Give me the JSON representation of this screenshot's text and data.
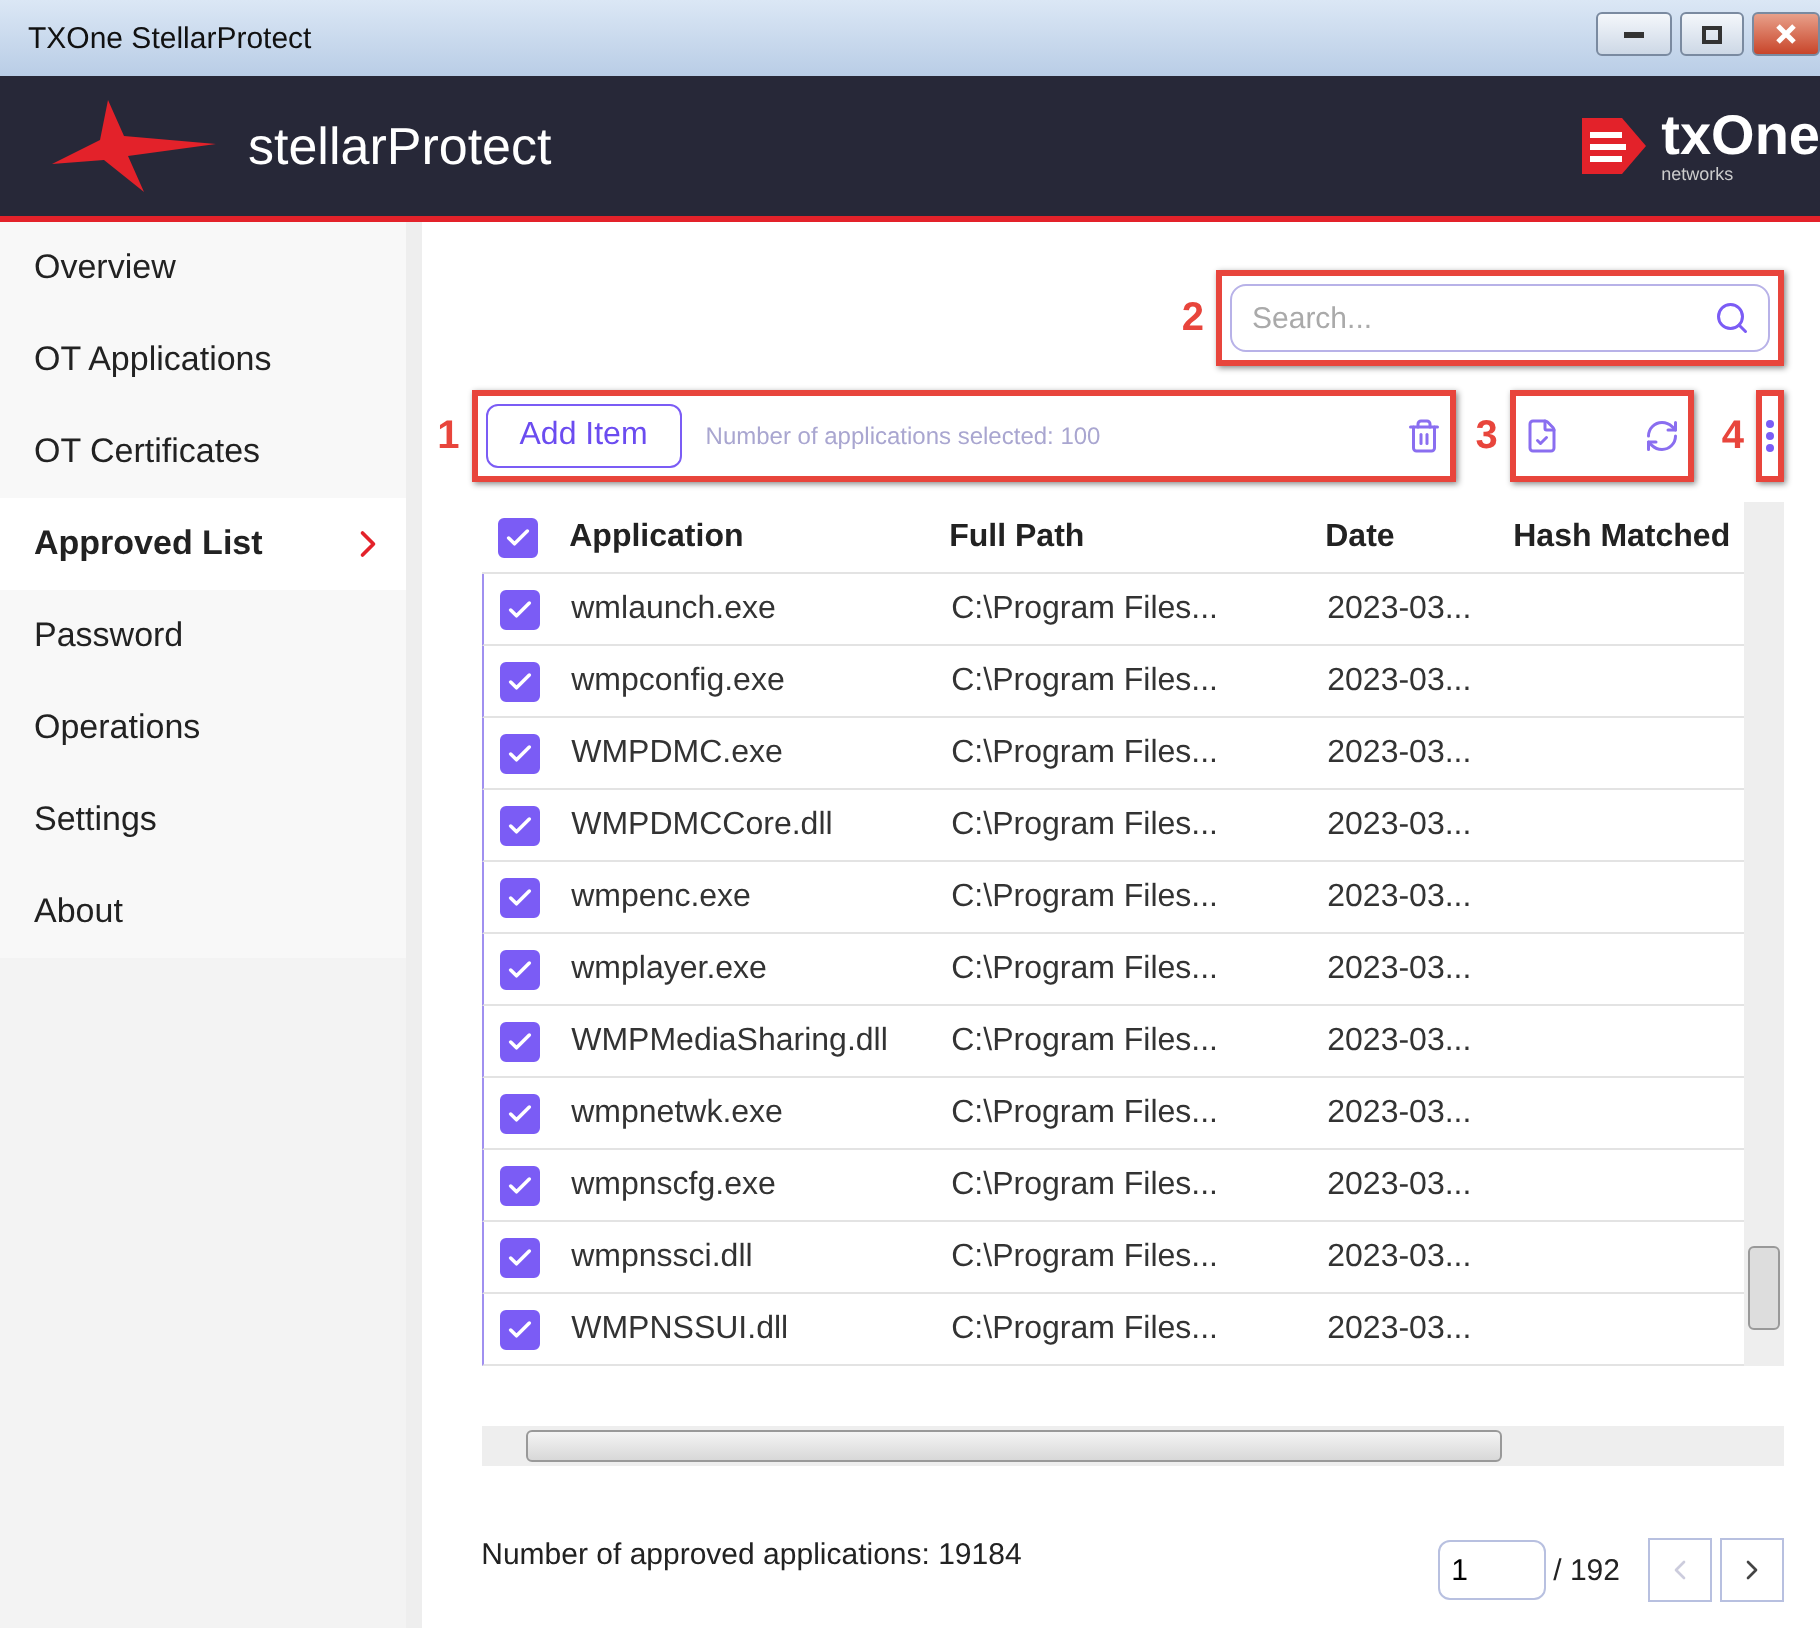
{
  "window": {
    "title": "TXOne StellarProtect"
  },
  "header": {
    "product": "stellarProtect",
    "brand": "txOne",
    "brand_sub": "networks"
  },
  "sidebar": {
    "items": [
      {
        "label": "Overview",
        "selected": false
      },
      {
        "label": "OT Applications",
        "selected": false
      },
      {
        "label": "OT Certificates",
        "selected": false
      },
      {
        "label": "Approved List",
        "selected": true
      },
      {
        "label": "Password",
        "selected": false
      },
      {
        "label": "Operations",
        "selected": false
      },
      {
        "label": "Settings",
        "selected": false
      },
      {
        "label": "About",
        "selected": false
      }
    ]
  },
  "callouts": [
    "1",
    "2",
    "3",
    "4"
  ],
  "search": {
    "placeholder": "Search..."
  },
  "toolbar": {
    "add_button": "Add Item",
    "selected_count": "Number of applications selected:  100"
  },
  "table": {
    "all_checked": true,
    "columns": [
      "Application",
      "Full Path",
      "Date",
      "Hash Matched"
    ],
    "rows": [
      {
        "checked": true,
        "cells": [
          "wmlaunch.exe",
          "C:\\Program Files...",
          "2023-03..."
        ]
      },
      {
        "checked": true,
        "cells": [
          "wmpconfig.exe",
          "C:\\Program Files...",
          "2023-03..."
        ]
      },
      {
        "checked": true,
        "cells": [
          "WMPDMC.exe",
          "C:\\Program Files...",
          "2023-03..."
        ]
      },
      {
        "checked": true,
        "cells": [
          "WMPDMCCore.dll",
          "C:\\Program Files...",
          "2023-03..."
        ]
      },
      {
        "checked": true,
        "cells": [
          "wmpenc.exe",
          "C:\\Program Files...",
          "2023-03..."
        ]
      },
      {
        "checked": true,
        "cells": [
          "wmplayer.exe",
          "C:\\Program Files...",
          "2023-03..."
        ]
      },
      {
        "checked": true,
        "cells": [
          "WMPMediaSharing.dll",
          "C:\\Program Files...",
          "2023-03..."
        ]
      },
      {
        "checked": true,
        "cells": [
          "wmpnetwk.exe",
          "C:\\Program Files...",
          "2023-03..."
        ]
      },
      {
        "checked": true,
        "cells": [
          "wmpnscfg.exe",
          "C:\\Program Files...",
          "2023-03..."
        ]
      },
      {
        "checked": true,
        "cells": [
          "wmpnssci.dll",
          "C:\\Program Files...",
          "2023-03..."
        ]
      },
      {
        "checked": true,
        "cells": [
          "WMPNSSUI.dll",
          "C:\\Program Files...",
          "2023-03..."
        ]
      }
    ]
  },
  "footer": {
    "total": "Number of approved applications: 19184",
    "page": "1",
    "pages": "/ 192"
  }
}
